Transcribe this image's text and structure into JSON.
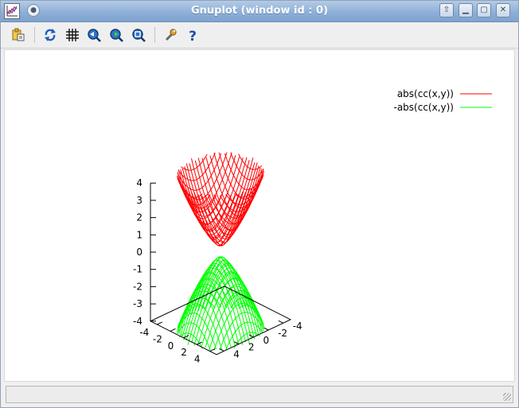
{
  "window": {
    "title": "Gnuplot (window id : 0)"
  },
  "titlebar_buttons": [
    {
      "name": "shade-up-button",
      "glyph": "⇧"
    },
    {
      "name": "minimize-button",
      "glyph": "▁"
    },
    {
      "name": "maximize-button",
      "glyph": "▢"
    },
    {
      "name": "close-button",
      "glyph": "✕"
    }
  ],
  "toolbar": [
    {
      "name": "export-icon"
    },
    {
      "name": "replot-icon"
    },
    {
      "name": "grid-icon"
    },
    {
      "name": "prev-zoom-icon"
    },
    {
      "name": "next-zoom-icon"
    },
    {
      "name": "autoscale-icon"
    },
    {
      "name": "settings-icon"
    },
    {
      "name": "help-icon"
    }
  ],
  "legend": [
    {
      "label": "abs(cc(x,y))",
      "color": "#ff0000"
    },
    {
      "label": "-abs(cc(x,y))",
      "color": "#00ff00"
    }
  ],
  "chart_data": {
    "type": "surface-3d",
    "series": [
      {
        "name": "abs(cc(x,y))",
        "color": "#ff0000",
        "sign": 1
      },
      {
        "name": "-abs(cc(x,y))",
        "color": "#00ff00",
        "sign": -1
      }
    ],
    "x_range": [
      -5,
      5
    ],
    "y_range": [
      -5,
      5
    ],
    "z_range": [
      -4,
      4
    ],
    "x_ticks": [
      "-4",
      "-2",
      "0",
      "2",
      "4"
    ],
    "y_ticks": [
      "-4",
      "-2",
      "0",
      "2",
      "4"
    ],
    "z_ticks": [
      "4",
      "3",
      "2",
      "1",
      "0",
      "-1",
      "-2",
      "-3",
      "-4"
    ],
    "grid": false,
    "legend_position": "top-right"
  },
  "status": {
    "text": ""
  }
}
